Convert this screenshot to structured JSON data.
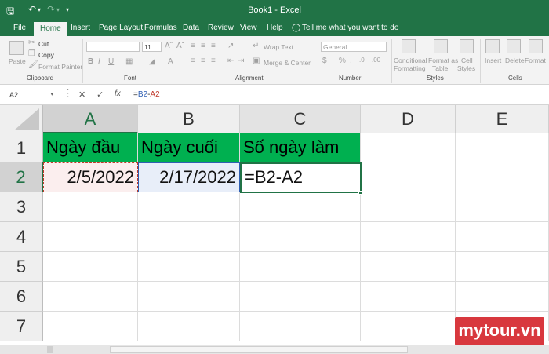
{
  "titlebar": {
    "title": "Book1  -  Excel",
    "save_icon": "save-icon",
    "undo_icon": "undo-icon",
    "redo_icon": "redo-icon",
    "customize_icon": "customize-icon",
    "accent": "#217346"
  },
  "tabs": [
    "File",
    "Home",
    "Insert",
    "Page Layout",
    "Formulas",
    "Data",
    "Review",
    "View",
    "Help"
  ],
  "tell_me": "Tell me what you want to do",
  "ribbon": {
    "clipboard": {
      "paste": "Paste",
      "cut": "Cut",
      "copy": "Copy",
      "format_painter": "Format Painter",
      "label": "Clipboard"
    },
    "font": {
      "size": "11",
      "label": "Font",
      "bold": "B",
      "italic": "I",
      "underline": "U"
    },
    "alignment": {
      "wrap_text": "Wrap Text",
      "merge_center": "Merge & Center",
      "label": "Alignment"
    },
    "number": {
      "format": "General",
      "percent": "%",
      "comma": ",",
      "label": "Number"
    },
    "styles": {
      "conditional": "Conditional",
      "conditional2": "Formatting",
      "format_as": "Format as",
      "format_as2": "Table",
      "cell": "Cell",
      "cell2": "Styles",
      "label": "Styles"
    },
    "cells": {
      "insert": "Insert",
      "delete": "Delete",
      "format": "Format",
      "label": "Cells"
    }
  },
  "formula_bar": {
    "name_box": "A2",
    "cancel": "✕",
    "enter": "✓",
    "fx": "fx",
    "formula": "=B2-A2",
    "formula_parts": {
      "eq": "=",
      "ref1": "B2",
      "minus": "-",
      "ref2": "A2"
    }
  },
  "columns": [
    "A",
    "B",
    "C",
    "D",
    "E"
  ],
  "rows": [
    "1",
    "2",
    "3",
    "4",
    "5",
    "6",
    "7"
  ],
  "cells": {
    "A1": "Ngày đầu",
    "B1": "Ngày cuối",
    "C1": "Số ngày làm",
    "A2": "2/5/2022",
    "B2": "2/17/2022",
    "C2": "=B2-A2"
  },
  "colors": {
    "header_fill": "#00b050",
    "ref_red": "#c0392b",
    "ref_blue": "#2f5fb3"
  },
  "watermark": "mytour.vn"
}
